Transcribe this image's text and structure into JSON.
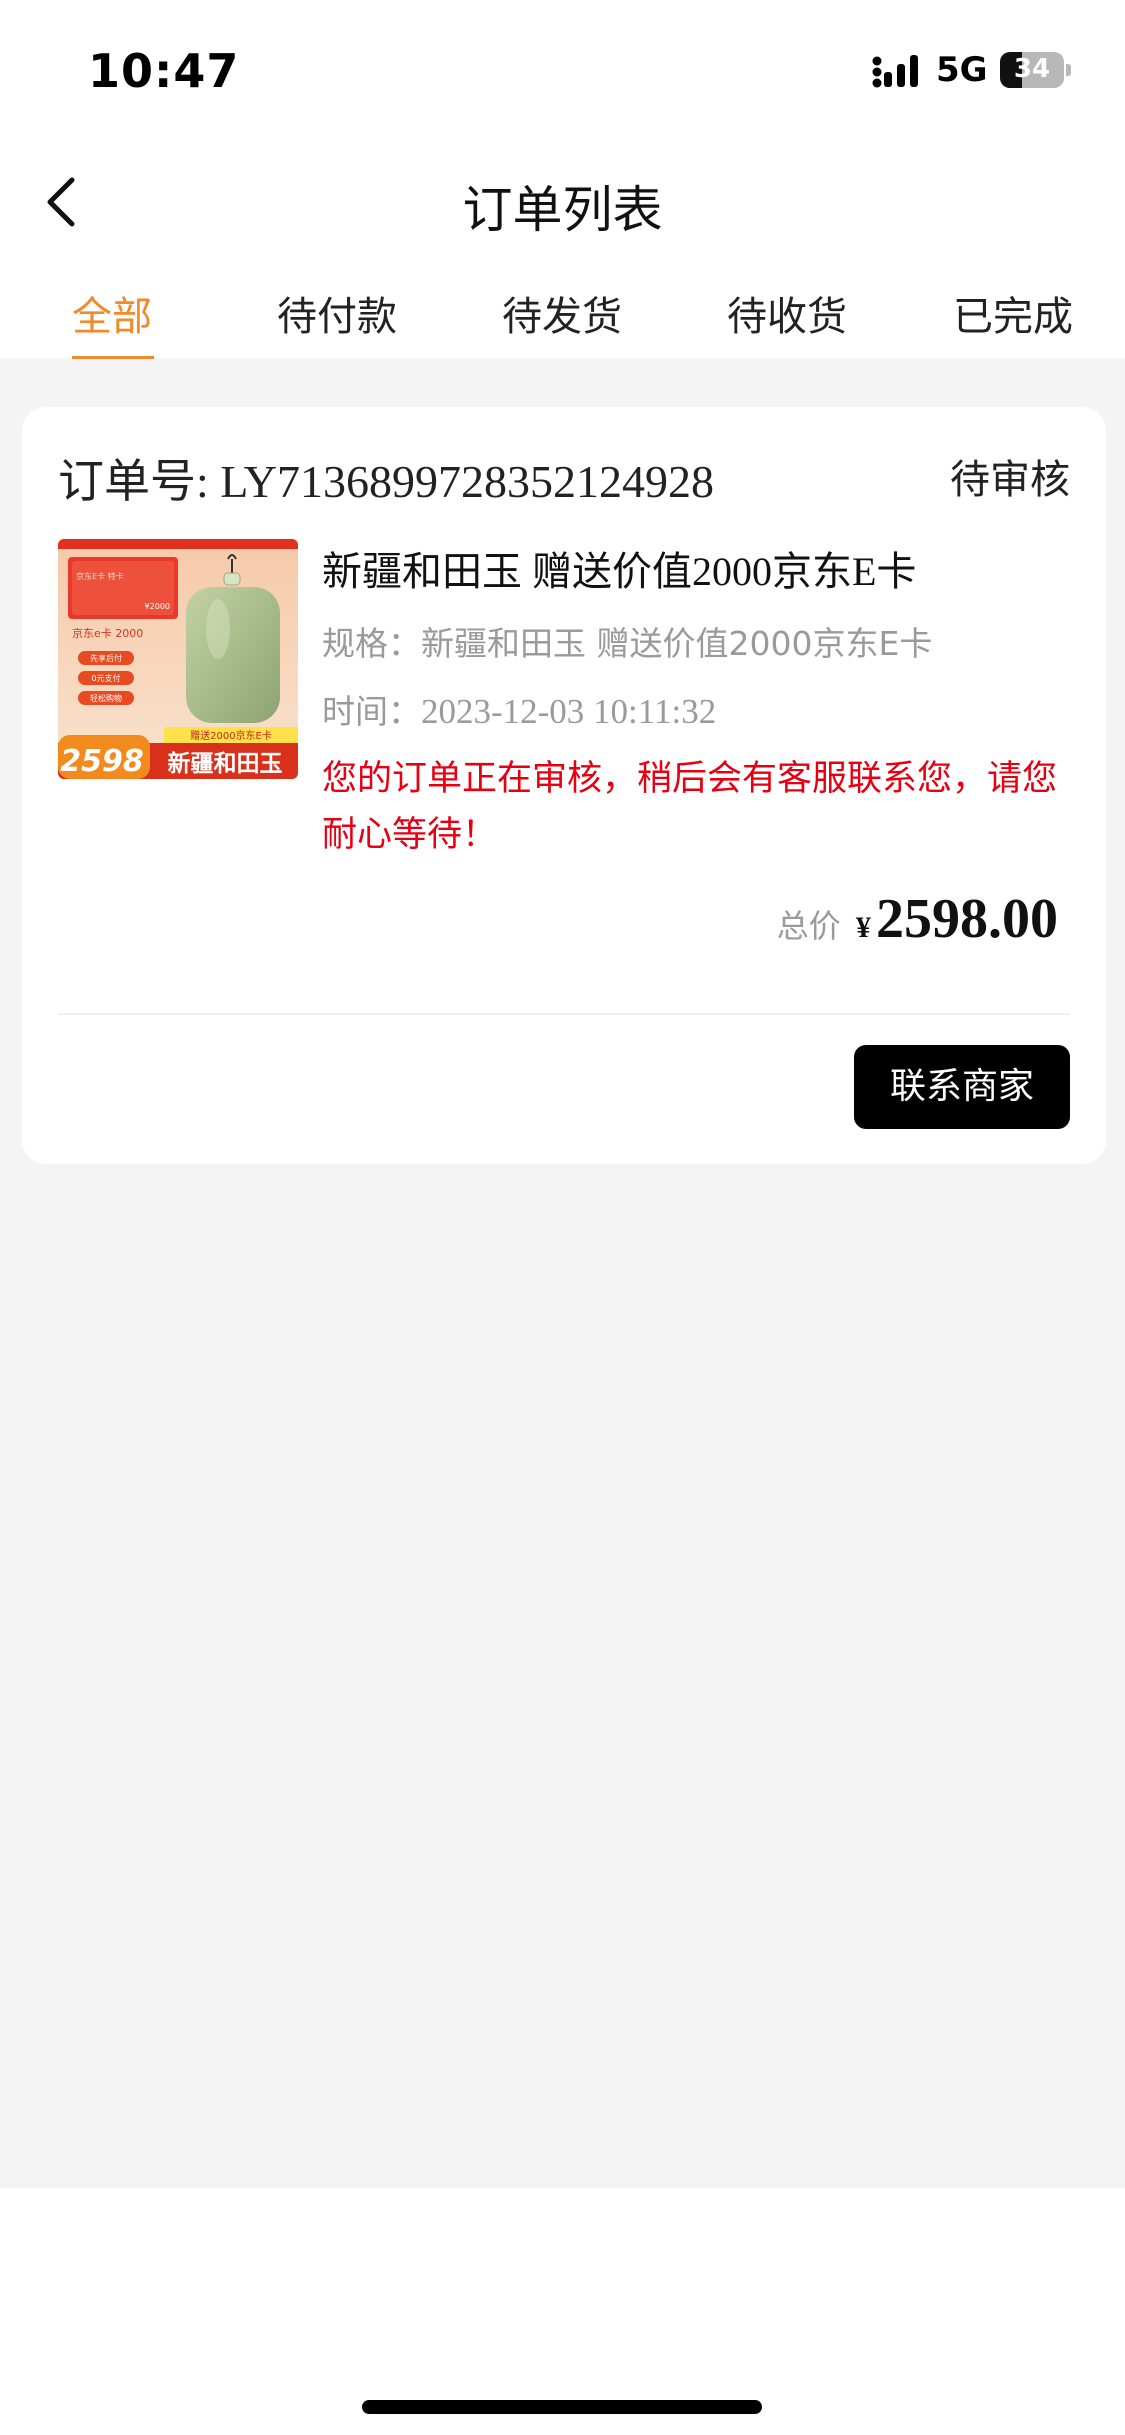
{
  "status_bar": {
    "time": "10:47",
    "network": "5G",
    "battery_percent": 34,
    "battery_label": "34"
  },
  "nav": {
    "title": "订单列表"
  },
  "tabs": [
    {
      "label": "全部",
      "active": true
    },
    {
      "label": "待付款",
      "active": false
    },
    {
      "label": "待发货",
      "active": false
    },
    {
      "label": "待收货",
      "active": false
    },
    {
      "label": "已完成",
      "active": false
    }
  ],
  "order": {
    "order_no_label": "订单号: LY7136899728352124928",
    "status": "待审核",
    "product_title": "新疆和田玉 赠送价值2000京东E卡",
    "spec_label": "规格：",
    "spec_value": "新疆和田玉 赠送价值2000京东E卡",
    "time_label": "时间：",
    "time_value": "2023-12-03 10:11:32",
    "notice": "您的订单正在审核，稍后会有客服联系您，请您耐心等待！",
    "total_label": "总价",
    "currency": "¥",
    "amount": "2598.00",
    "contact_button": "联系商家",
    "thumbnail": {
      "card_text": "京东e卡 2000",
      "card_small": "京东E卡 特卡",
      "card_value": "¥2000",
      "pills": [
        "先享后付",
        "0元支付",
        "轻松购物"
      ],
      "gift_banner": "赠送2000京东E卡",
      "price_badge": "2598",
      "name_banner": "新疆和田玉"
    }
  },
  "colors": {
    "accent": "#f08a2a",
    "notice": "#e60012",
    "button_bg": "#000000",
    "page_bg": "#f4f4f4"
  }
}
